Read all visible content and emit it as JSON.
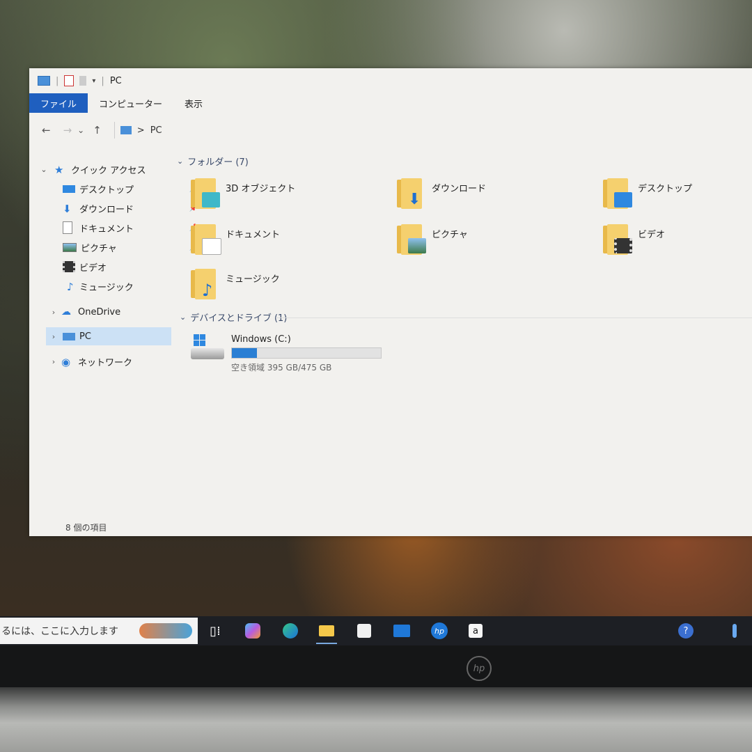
{
  "window": {
    "title": "PC",
    "ribbon_tabs": [
      {
        "label": "ファイル",
        "active": true
      },
      {
        "label": "コンピューター",
        "active": false
      },
      {
        "label": "表示",
        "active": false
      }
    ],
    "address": {
      "back": "←",
      "forward": "→",
      "recent": "⌄",
      "up": "↑",
      "separator": ">",
      "path": "PC"
    }
  },
  "nav": {
    "quick_access": "クイック アクセス",
    "quick_items": [
      "デスクトップ",
      "ダウンロード",
      "ドキュメント",
      "ピクチャ",
      "ビデオ",
      "ミュージック"
    ],
    "onedrive": "OneDrive",
    "pc": "PC",
    "network": "ネットワーク"
  },
  "content": {
    "folders_header": "フォルダー (7)",
    "folders": [
      "3D オブジェクト",
      "ダウンロード",
      "デスクトップ",
      "ドキュメント",
      "ピクチャ",
      "ビデオ",
      "ミュージック"
    ],
    "drives_header": "デバイスとドライブ (1)",
    "drive": {
      "name": "Windows (C:)",
      "free_text": "空き領域 395 GB/475 GB",
      "used_fraction": 0.168
    }
  },
  "status": {
    "count": "8 個の項目"
  },
  "taskbar": {
    "search_placeholder": "るには、ここに入力します"
  },
  "bezel": {
    "brand": "hp"
  },
  "colors": {
    "accent": "#1f5fbf",
    "selection": "#cce1f5",
    "folder": "#f5d06e",
    "bar": "#2a7fd4"
  }
}
